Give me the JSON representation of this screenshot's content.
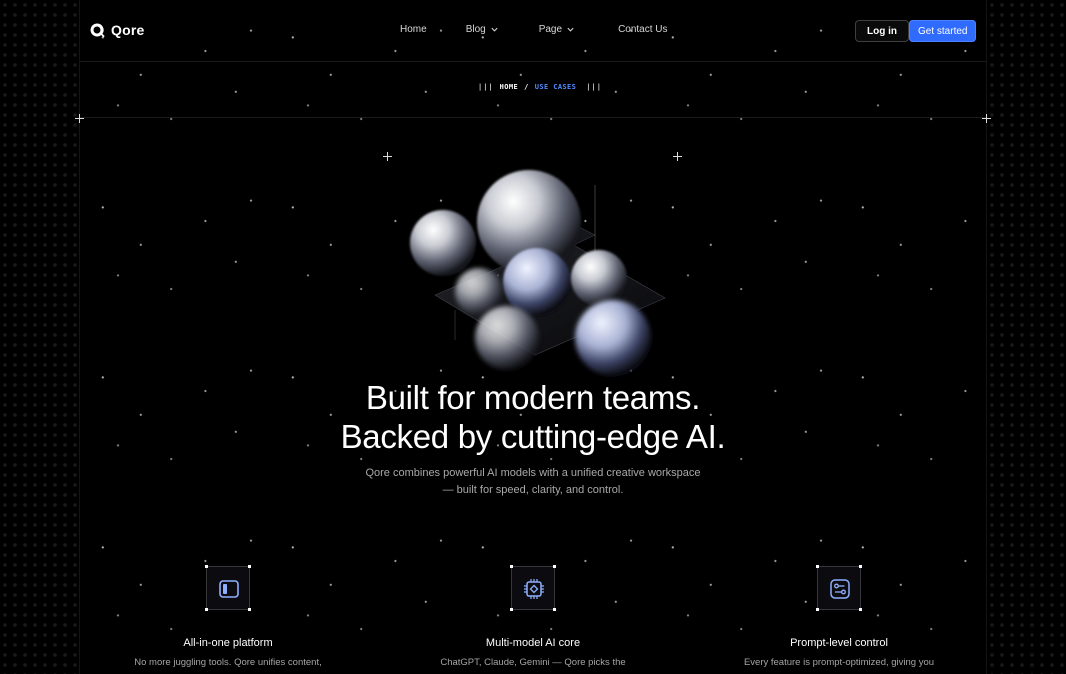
{
  "nav": {
    "brand": "Qore",
    "links": [
      {
        "label": "Home",
        "dropdown": false
      },
      {
        "label": "Blog",
        "dropdown": true
      },
      {
        "label": "Page",
        "dropdown": true
      },
      {
        "label": "Contact Us",
        "dropdown": false
      }
    ],
    "login_label": "Log in",
    "cta_label": "Get started"
  },
  "breadcrumb": {
    "bars_left": "|||",
    "home": "HOME",
    "separator": "/",
    "current": "USE CASES",
    "bars_right": "|||"
  },
  "hero": {
    "headline_line1": "Built for modern teams.",
    "headline_line2": "Backed by cutting-edge AI.",
    "subtitle_line1": "Qore combines powerful AI models with a unified creative workspace",
    "subtitle_line2": "— built for speed, clarity, and control."
  },
  "features": [
    {
      "icon": "sidebar-panel-icon",
      "title": "All-in-one platform",
      "description": "No more juggling tools. Qore unifies content,"
    },
    {
      "icon": "ai-chip-icon",
      "title": "Multi-model AI core",
      "description": "ChatGPT, Claude, Gemini — Qore picks the"
    },
    {
      "icon": "sliders-icon",
      "title": "Prompt-level control",
      "description": "Every feature is prompt-optimized, giving you"
    }
  ],
  "colors": {
    "background": "#000000",
    "accent": "#2f6bff",
    "breadcrumb_active": "#4f8bff",
    "icon_accent": "#8fb0ff"
  }
}
